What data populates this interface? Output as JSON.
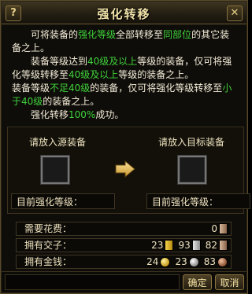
{
  "window": {
    "title": "强化转移",
    "help_label": "?",
    "close_label": "✕"
  },
  "description": {
    "p1": [
      "可将装备的",
      "强化等级",
      "全部转移至",
      "同部位",
      "的其它装备之上。"
    ],
    "p2": [
      "装备等级达到",
      "40级及以上",
      "等级的装备，仅可将强化等级转移至",
      "40级及以上",
      "等级的装备之上。"
    ],
    "p3": [
      "装备等级",
      "不足40级",
      "的装备，仅可将强化等级转移至",
      "小于40级",
      "的装备之上。"
    ],
    "p4": [
      "强化转移",
      "100%",
      "成功。"
    ]
  },
  "equipment": {
    "source_label": "请放入源装备",
    "target_label": "请放入目标装备",
    "source_level_label": "目前强化等级：",
    "target_level_label": "目前强化等级："
  },
  "costs": {
    "required_label": "需要花费：",
    "required_value": "0",
    "jiaozi_label": "拥有交子：",
    "jiaozi": {
      "gold": "23",
      "silver": "93",
      "copper": "82"
    },
    "money_label": "拥有金钱：",
    "money": {
      "gold": "24",
      "silver": "23",
      "copper": "83"
    }
  },
  "buttons": {
    "confirm": "确定",
    "cancel": "取消"
  },
  "colors": {
    "highlight": "#3ed23a",
    "title": "#f0e2a8",
    "text": "#f3ecd8"
  },
  "icons": [
    "help-icon",
    "close-icon",
    "arrow-right-icon",
    "note-icon",
    "coin-icon"
  ]
}
